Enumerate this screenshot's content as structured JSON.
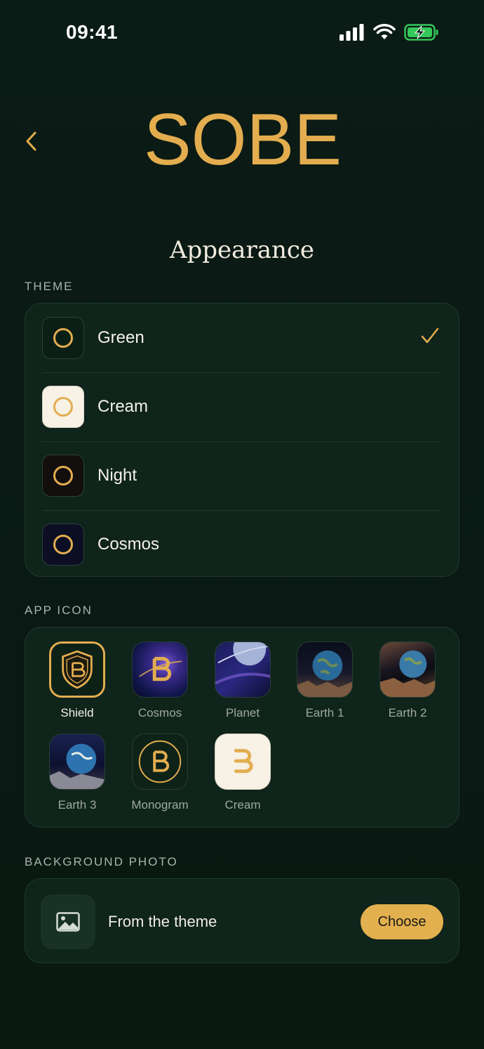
{
  "status_bar": {
    "time": "09:41"
  },
  "header": {
    "logo_text": "SOBE"
  },
  "page_title": "Appearance",
  "theme": {
    "label": "THEME",
    "items": [
      {
        "name": "Green",
        "swatch": "#0b1f16",
        "selected": true
      },
      {
        "name": "Cream",
        "swatch": "#f7f1e6",
        "selected": false
      },
      {
        "name": "Night",
        "swatch": "#120f0e",
        "selected": false
      },
      {
        "name": "Cosmos",
        "swatch": "#0c0f24",
        "selected": false
      }
    ]
  },
  "app_icon": {
    "label": "APP ICON",
    "items": [
      {
        "name": "Shield",
        "selected": true
      },
      {
        "name": "Cosmos",
        "selected": false
      },
      {
        "name": "Planet",
        "selected": false
      },
      {
        "name": "Earth 1",
        "selected": false
      },
      {
        "name": "Earth 2",
        "selected": false
      },
      {
        "name": "Earth 3",
        "selected": false
      },
      {
        "name": "Monogram",
        "selected": false
      },
      {
        "name": "Cream",
        "selected": false
      }
    ]
  },
  "background_photo": {
    "label": "BACKGROUND PHOTO",
    "value": "From the theme",
    "button": "Choose"
  },
  "colors": {
    "accent": "#e3ad4f",
    "background": "#0b1a14",
    "card": "#0f241b"
  }
}
